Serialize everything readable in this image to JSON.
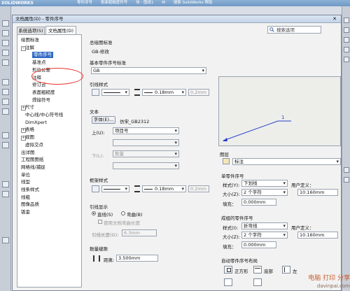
{
  "app": {
    "brand": "SOLIDWORKS",
    "toolbar_items": [
      "零件序号",
      "表面粗糙度符号",
      "M",
      "搜索 SolidWorks 帮助"
    ],
    "doc_label": "块 - 图纸1"
  },
  "dialog": {
    "title": "文档属性(D) - 零件序号",
    "tabs": [
      "系统选项(S)",
      "文档属性(D)"
    ],
    "search_placeholder": "搜索选项"
  },
  "tree": {
    "items": [
      {
        "label": "绘图标准",
        "indent": 0
      },
      {
        "label": "注解",
        "indent": 1,
        "expander": "−"
      },
      {
        "label": "零件序号",
        "indent": 2,
        "selected": true
      },
      {
        "label": "基准点",
        "indent": 2
      },
      {
        "label": "形位公差",
        "indent": 2
      },
      {
        "label": "注释",
        "indent": 2
      },
      {
        "label": "修订云",
        "indent": 2
      },
      {
        "label": "表面粗糙度",
        "indent": 2
      },
      {
        "label": "焊接符号",
        "indent": 2
      },
      {
        "label": "尺寸",
        "indent": 1,
        "expander": "+"
      },
      {
        "label": "中心线/中心符号线",
        "indent": 1
      },
      {
        "label": "DimXpert",
        "indent": 1
      },
      {
        "label": "表格",
        "indent": 1,
        "expander": "+"
      },
      {
        "label": "视图",
        "indent": 1,
        "expander": "+"
      },
      {
        "label": "虚拟交点",
        "indent": 1
      },
      {
        "label": "出详图",
        "indent": 0
      },
      {
        "label": "工程图图纸",
        "indent": 0
      },
      {
        "label": "网格线/捕捉",
        "indent": 0
      },
      {
        "label": "单位",
        "indent": 0
      },
      {
        "label": "线型",
        "indent": 0
      },
      {
        "label": "线条样式",
        "indent": 0
      },
      {
        "label": "线粗",
        "indent": 0
      },
      {
        "label": "图像品质",
        "indent": 0
      },
      {
        "label": "钣金",
        "indent": 0
      }
    ]
  },
  "panel": {
    "overall_standard_label": "总绘图标准",
    "overall_standard_value": "GB-修改",
    "base_standard_label": "基本零件序号标准",
    "base_standard_value": "GB",
    "leader_style_label": "引线样式",
    "leader_thickness": "0.18mm",
    "leader_custom": "0.2mm",
    "text_label": "文本",
    "font_button": "字体(E)...",
    "font_name": "仿宋_GB2312",
    "upper_label": "上(U):",
    "upper_value": "项目号",
    "lower_label": "下(L):",
    "lower_value": "数量",
    "frame_style_label": "框架样式",
    "frame_thickness": "0.18mm",
    "frame_custom": "0.2mm",
    "leader_display_label": "引线显示",
    "straight_label": "直线(S)",
    "bent_label": "弯曲(B)",
    "use_doc_bend_label": "使用文档弯曲长度",
    "leader_length_label": "引线长度(G):",
    "leader_length_value": "6.3mm",
    "qty_spacing_label": "数量缝隙",
    "distance_label": "距离:",
    "distance_value": "3.500mm",
    "preview_label": "1",
    "layer_label": "图层",
    "layer_value": "标注",
    "single_label": "单零件序号",
    "style_label": "样式(Y):",
    "style_value": "下划线",
    "size_label": "大小(Z):",
    "size_value": "2 个字符",
    "user_defined_label": "用户定义：",
    "user_defined_value": "10.160mm",
    "padding_label": "填充：",
    "padding_value": "0.000mm",
    "stacked_label": "成组的零件序号",
    "stacked_style_label": "样式(I):",
    "stacked_style_value": "折弯线",
    "stacked_size_label": "大小(Z):",
    "stacked_size_value": "2 个字符",
    "stacked_user_label": "用户定义：",
    "stacked_user_value": "10.160mm",
    "stacked_padding_label": "填充：",
    "stacked_padding_value": "0.000mm",
    "auto_layout_label": "自动零件序号布局",
    "layout_square": "正方形",
    "layout_top": "底部",
    "layout_left": "左"
  },
  "watermark": {
    "text": "电脑 打印 分享",
    "url": "davinpai.com"
  },
  "colors": {
    "accent": "#316ac5",
    "highlight": "#e8322c",
    "preview_leader": "#2b3fc8"
  }
}
